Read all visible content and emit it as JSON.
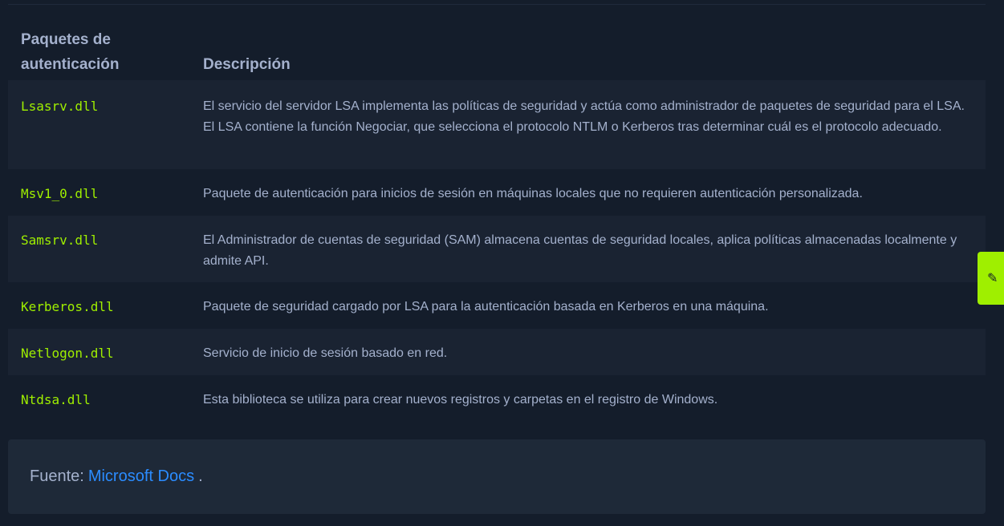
{
  "table": {
    "headers": {
      "package": "Paquetes de autenticación",
      "description": "Descripción"
    },
    "rows": [
      {
        "name": "Lsasrv.dll",
        "description": "El servicio del servidor LSA implementa las políticas de seguridad y actúa como administrador de paquetes de seguridad para el LSA. El LSA contiene la función Negociar, que selecciona el protocolo NTLM o Kerberos tras determinar cuál es el protocolo adecuado."
      },
      {
        "name": "Msv1_0.dll",
        "description": "Paquete de autenticación para inicios de sesión en máquinas locales que no requieren autenticación personalizada."
      },
      {
        "name": "Samsrv.dll",
        "description": "El Administrador de cuentas de seguridad (SAM) almacena cuentas de seguridad locales, aplica políticas almacenadas localmente y admite API."
      },
      {
        "name": "Kerberos.dll",
        "description": "Paquete de seguridad cargado por LSA para la autenticación basada en Kerberos en una máquina."
      },
      {
        "name": "Netlogon.dll",
        "description": "Servicio de inicio de sesión basado en red."
      },
      {
        "name": "Ntdsa.dll",
        "description": "Esta biblioteca se utiliza para crear nuevos registros y carpetas en el registro de Windows."
      }
    ]
  },
  "source": {
    "prefix": "Fuente:",
    "link_text": "Microsoft Docs",
    "suffix": "."
  },
  "edit_tab": {
    "icon": "pencil-icon",
    "glyph": "✎"
  },
  "colors": {
    "background": "#141d2b",
    "row_alt": "#1a2332",
    "text": "#a4b1cd",
    "code": "#9fef00",
    "link": "#2b8cff",
    "accent": "#9fef00"
  }
}
